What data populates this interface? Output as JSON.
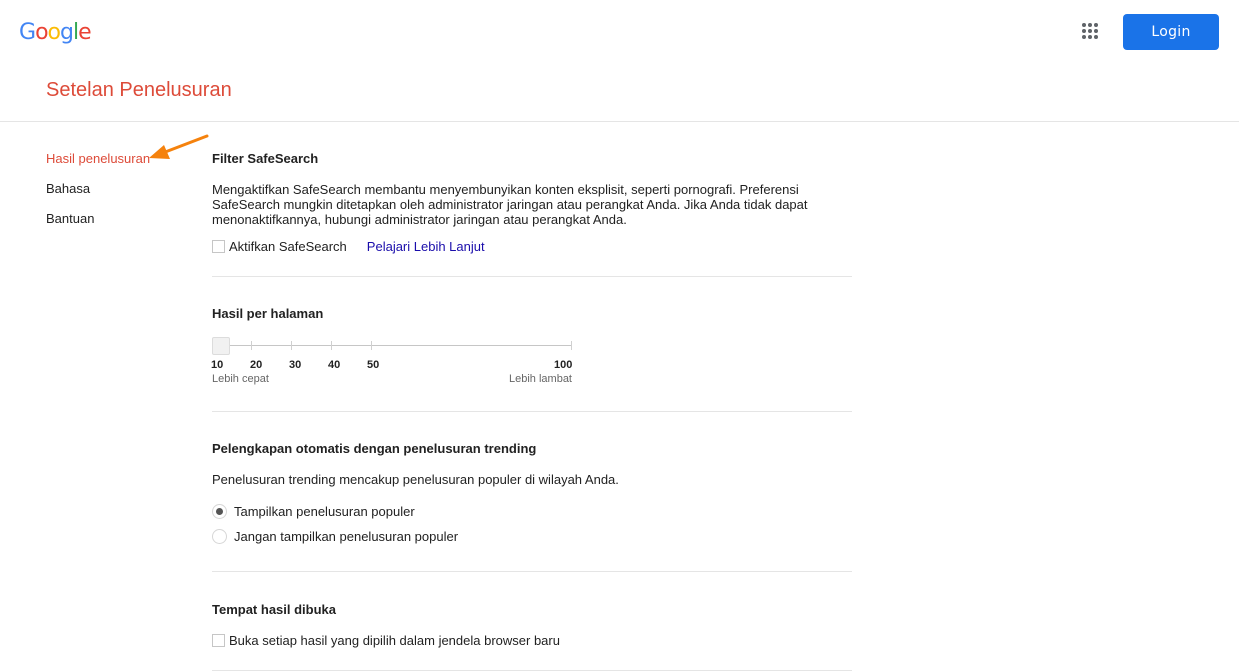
{
  "header": {
    "logo_letters": [
      {
        "char": "G",
        "color": "#4285f4"
      },
      {
        "char": "o",
        "color": "#ea4335"
      },
      {
        "char": "o",
        "color": "#fbbc05"
      },
      {
        "char": "g",
        "color": "#4285f4"
      },
      {
        "char": "l",
        "color": "#34a853"
      },
      {
        "char": "e",
        "color": "#ea4335"
      }
    ],
    "apps_icon": "apps-grid-icon",
    "login_label": "Login"
  },
  "page_title": "Setelan Penelusuran",
  "sidebar": {
    "items": [
      {
        "label": "Hasil penelusuran",
        "active": true
      },
      {
        "label": "Bahasa",
        "active": false
      },
      {
        "label": "Bantuan",
        "active": false
      }
    ]
  },
  "annotation": {
    "type": "arrow",
    "color": "#f5820d"
  },
  "sections": {
    "safesearch": {
      "title": "Filter SafeSearch",
      "description": "Mengaktifkan SafeSearch membantu menyembunyikan konten eksplisit, seperti pornografi. Preferensi SafeSearch mungkin ditetapkan oleh administrator jaringan atau perangkat Anda. Jika Anda tidak dapat menonaktifkannya, hubungi administrator jaringan atau perangkat Anda.",
      "checkbox_label": "Aktifkan SafeSearch",
      "checked": false,
      "link_label": "Pelajari Lebih Lanjut"
    },
    "results_per_page": {
      "title": "Hasil per halaman",
      "stops": [
        "10",
        "20",
        "30",
        "40",
        "50",
        "100"
      ],
      "selected": "10",
      "caption_left": "Lebih cepat",
      "caption_right": "Lebih lambat"
    },
    "autocomplete": {
      "title": "Pelengkapan otomatis dengan penelusuran trending",
      "description": "Penelusuran trending mencakup penelusuran populer di wilayah Anda.",
      "options": [
        {
          "label": "Tampilkan penelusuran populer",
          "selected": true
        },
        {
          "label": "Jangan tampilkan penelusuran populer",
          "selected": false
        }
      ]
    },
    "open_results": {
      "title": "Tempat hasil dibuka",
      "checkbox_label": "Buka setiap hasil yang dipilih dalam jendela browser baru",
      "checked": false
    }
  }
}
